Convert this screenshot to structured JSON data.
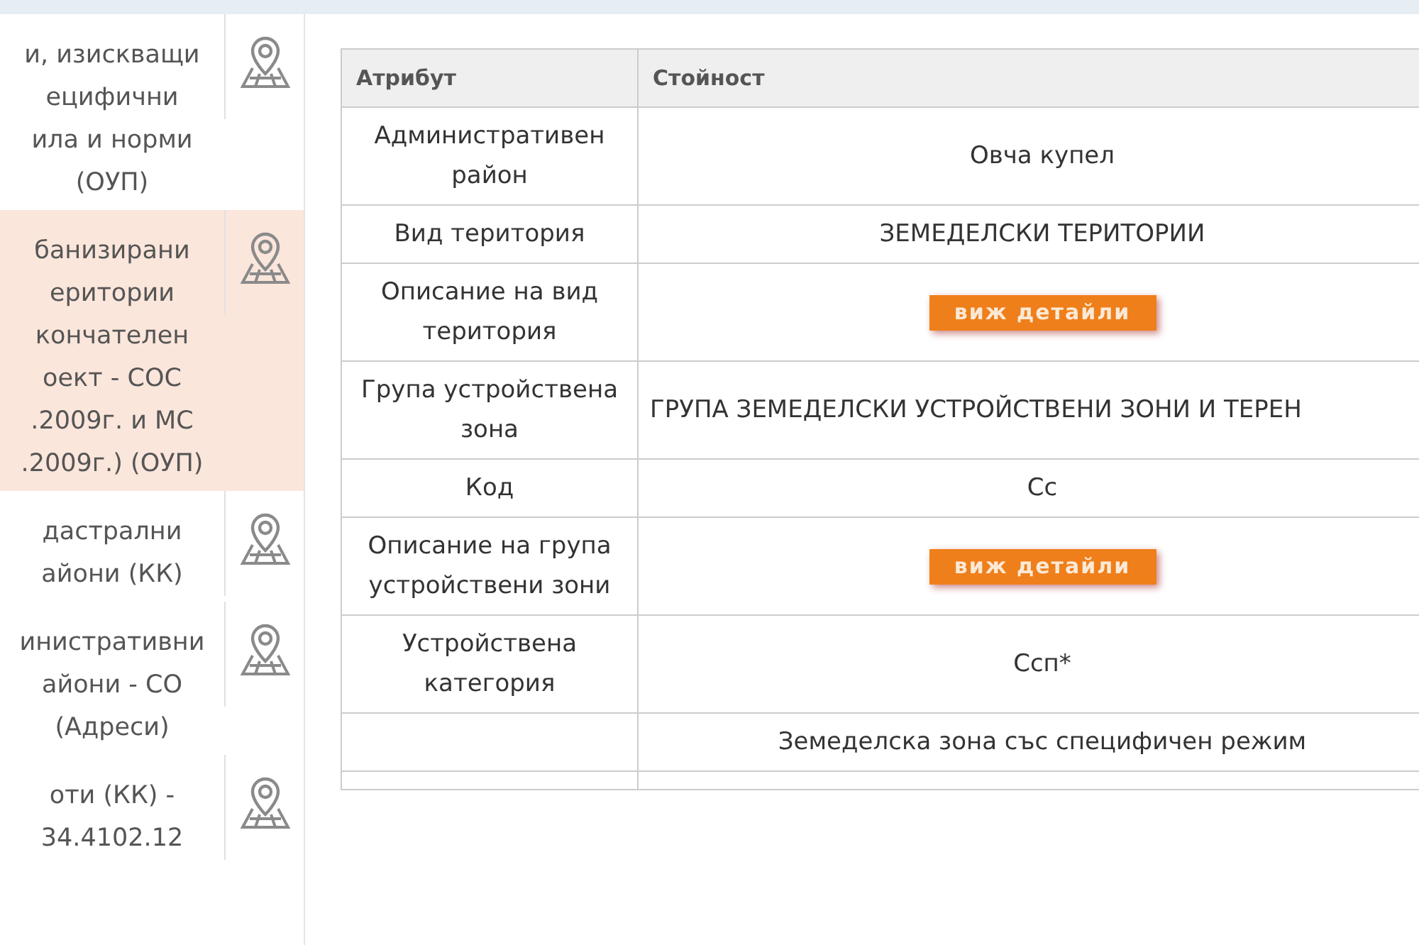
{
  "sidebar": {
    "items": [
      {
        "lines": [
          "и, изискващи",
          "ецифични",
          "ила и норми",
          "(ОУП)"
        ],
        "selected": false
      },
      {
        "lines": [
          "банизирани",
          "еритории",
          "кончателен",
          "оект - СОС",
          ".2009г. и МС",
          ".2009г.) (ОУП)"
        ],
        "selected": true
      },
      {
        "lines": [
          "дастрални",
          "айони (КК)"
        ],
        "selected": false
      },
      {
        "lines": [
          "инистративни",
          "айони - СО",
          "(Адреси)"
        ],
        "selected": false
      },
      {
        "lines": [
          "оти (КК) -",
          "34.4102.12"
        ],
        "selected": false
      }
    ]
  },
  "table": {
    "columns": [
      "Атрибут",
      "Стойност"
    ],
    "rows": [
      {
        "attribute": "Административен район",
        "kind": "text",
        "value": "Овча купел"
      },
      {
        "attribute": "Вид територия",
        "kind": "text",
        "value": "ЗЕМЕДЕЛСКИ ТЕРИТОРИИ"
      },
      {
        "attribute": "Описание на вид територия",
        "kind": "button",
        "value": "виж детайли"
      },
      {
        "attribute": "Група устройствена зона",
        "kind": "long",
        "value": "ГРУПА ЗЕМЕДЕЛСКИ УСТРОЙСТВЕНИ ЗОНИ И ТЕРЕН"
      },
      {
        "attribute": "Код",
        "kind": "text",
        "value": "Сс"
      },
      {
        "attribute": "Описание на група устройствени зони",
        "kind": "button",
        "value": "виж детайли"
      },
      {
        "attribute": "Устройствена категория",
        "kind": "text",
        "value": "Ссп*"
      },
      {
        "kind": "text",
        "value": "Земеделска зона със специфичен режим"
      }
    ]
  }
}
